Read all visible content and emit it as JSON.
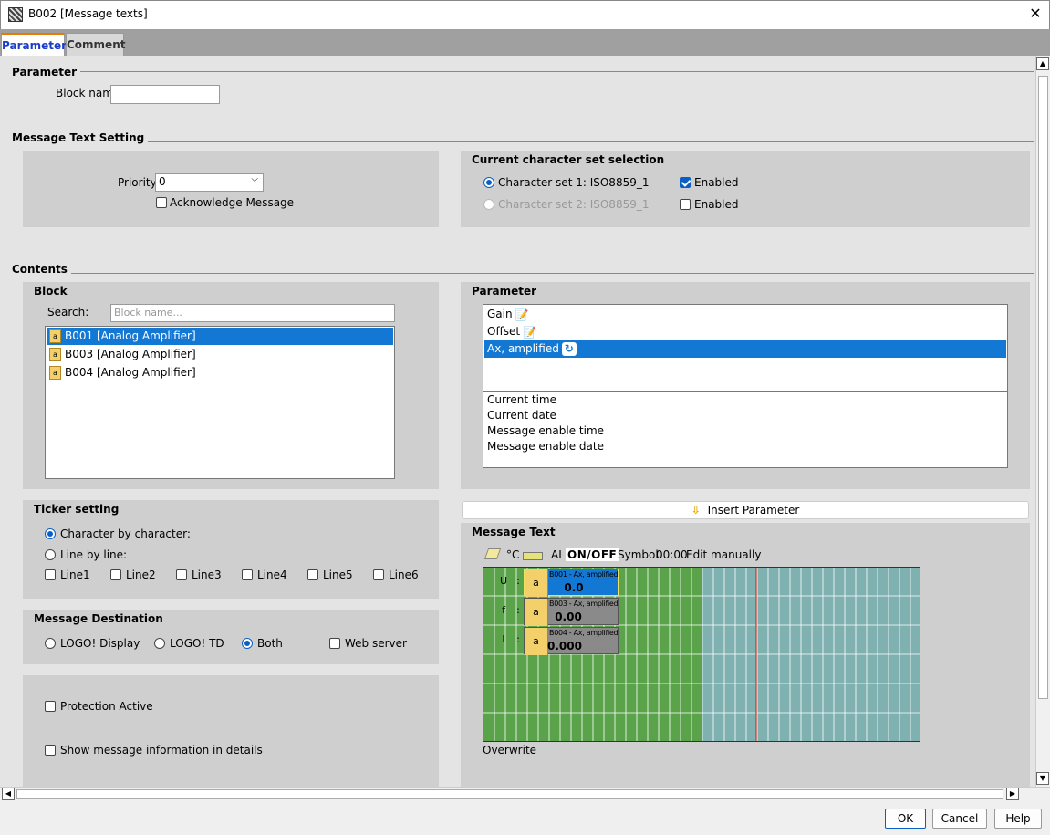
{
  "window": {
    "title": "B002 [Message texts]",
    "close_glyph": "✕"
  },
  "tabs": [
    "Parameter",
    "Comment"
  ],
  "parameter_section": {
    "heading": "Parameter",
    "block_name_label": "Block name:",
    "block_name_value": ""
  },
  "message_text_setting": {
    "heading": "Message Text Setting",
    "priority_label": "Priority:",
    "priority_value": "0",
    "acknowledge_label": "Acknowledge Message",
    "acknowledge_checked": false,
    "charset": {
      "title": "Current character set selection",
      "set1_label": "Character set 1: ISO8859_1",
      "set1_selected": true,
      "set1_enabled_label": "Enabled",
      "set1_enabled_checked": true,
      "set2_label": "Character set 2: ISO8859_1",
      "set2_selected": false,
      "set2_enabled_label": "Enabled",
      "set2_enabled_checked": false
    }
  },
  "contents": {
    "heading": "Contents",
    "block": {
      "title": "Block",
      "search_label": "Search:",
      "search_placeholder": "Block name...",
      "items": [
        "B001 [Analog Amplifier]",
        "B003 [Analog Amplifier]",
        "B004 [Analog Amplifier]"
      ],
      "selected_index": 0
    },
    "parameter": {
      "title": "Parameter",
      "items": [
        "Gain",
        "Offset",
        "Ax, amplified"
      ],
      "selected_index": 2,
      "other_items": [
        "Current time",
        "Current date",
        "Message enable time",
        "Message enable date"
      ]
    },
    "insert_parameter_label": "Insert Parameter"
  },
  "ticker": {
    "title": "Ticker setting",
    "char_by_char_label": "Character by character:",
    "line_by_line_label": "Line by line:",
    "lines": [
      "Line1",
      "Line2",
      "Line3",
      "Line4",
      "Line5",
      "Line6"
    ]
  },
  "destination": {
    "title": "Message Destination",
    "options": [
      "LOGO! Display",
      "LOGO! TD",
      "Both"
    ],
    "selected": "Both",
    "web_server_label": "Web server"
  },
  "protection": {
    "protection_label": "Protection Active",
    "show_info_label": "Show message information in details"
  },
  "message_text": {
    "title": "Message Text",
    "toolbar": {
      "celsius": "°C",
      "ai": "AI",
      "onoff": "ON/OFF",
      "symbol": "Symbol",
      "time": "00:00",
      "edit_manually": "Edit manually"
    },
    "row_labels": [
      "U",
      "f",
      "I"
    ],
    "colon": ":",
    "params": [
      {
        "name": "B001 - Ax, amplified",
        "value": "0.0",
        "selected": true
      },
      {
        "name": "B003 - Ax, amplified",
        "value": "0.00",
        "selected": false
      },
      {
        "name": "B004 - Ax, amplified",
        "value": "0.000",
        "selected": false
      }
    ],
    "overwrite_label": "Overwrite",
    "colors": {
      "green": "#5aa34a",
      "teal": "#7fb1b1",
      "cursor": "#c0392b"
    }
  },
  "footer": {
    "ok": "OK",
    "cancel": "Cancel",
    "help": "Help"
  }
}
